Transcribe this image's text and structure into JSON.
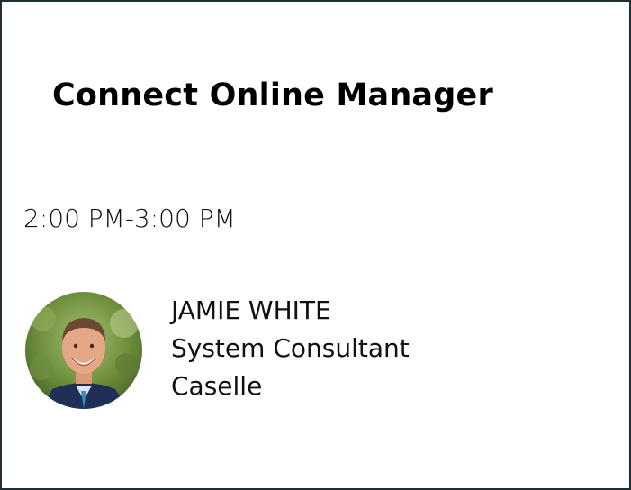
{
  "session": {
    "title": "Connect Online Manager",
    "time": "2:00 PM-3:00 PM"
  },
  "speaker": {
    "name": "JAMIE WHITE",
    "role": "System Consultant",
    "company": "Caselle",
    "avatar_icon": "speaker-photo"
  },
  "colors": {
    "border": "#1f2f36",
    "text": "#111111"
  }
}
